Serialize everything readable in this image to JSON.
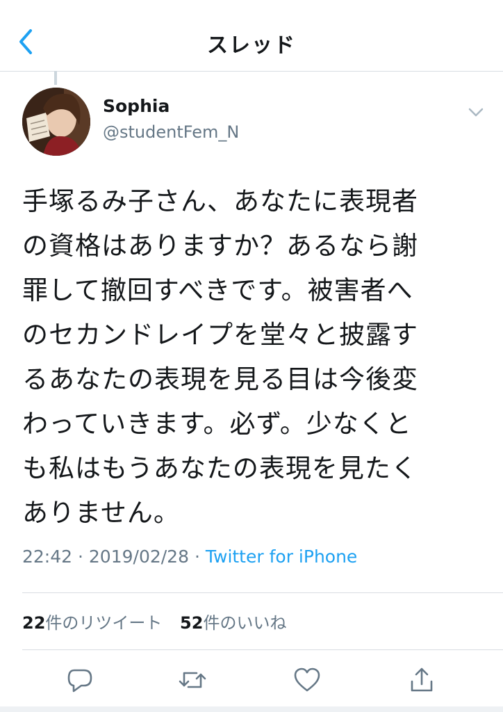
{
  "nav": {
    "title": "スレッド",
    "back_icon": "chevron-left-icon"
  },
  "tweet": {
    "author": {
      "display_name": "Sophia",
      "handle": "@studentFem_N"
    },
    "text_lines": [
      "手塚るみ子さん、あなたに表現者",
      "の資格はありますか？あるなら謝",
      "罪して撤回すべきです。被害者へ",
      "のセカンドレイプを堂々と披露す",
      "るあなたの表現を見る目は今後変",
      "わっていきます。必ず。少なくと",
      "も私はもうあなたの表現を見たく",
      "ありません。"
    ],
    "time": "22:42",
    "separator": "·",
    "date": "2019/02/28",
    "source": "Twitter for iPhone"
  },
  "stats": {
    "retweets_count": "22",
    "retweets_label": "件のリツイート",
    "likes_count": "52",
    "likes_label": "件のいいね"
  },
  "actions": [
    {
      "icon": "reply-icon"
    },
    {
      "icon": "retweet-icon"
    },
    {
      "icon": "like-icon"
    },
    {
      "icon": "share-icon"
    }
  ],
  "colors": {
    "accent": "#1da1f2",
    "text": "#14171a",
    "secondary": "#657786",
    "divider": "#d8dde2"
  }
}
